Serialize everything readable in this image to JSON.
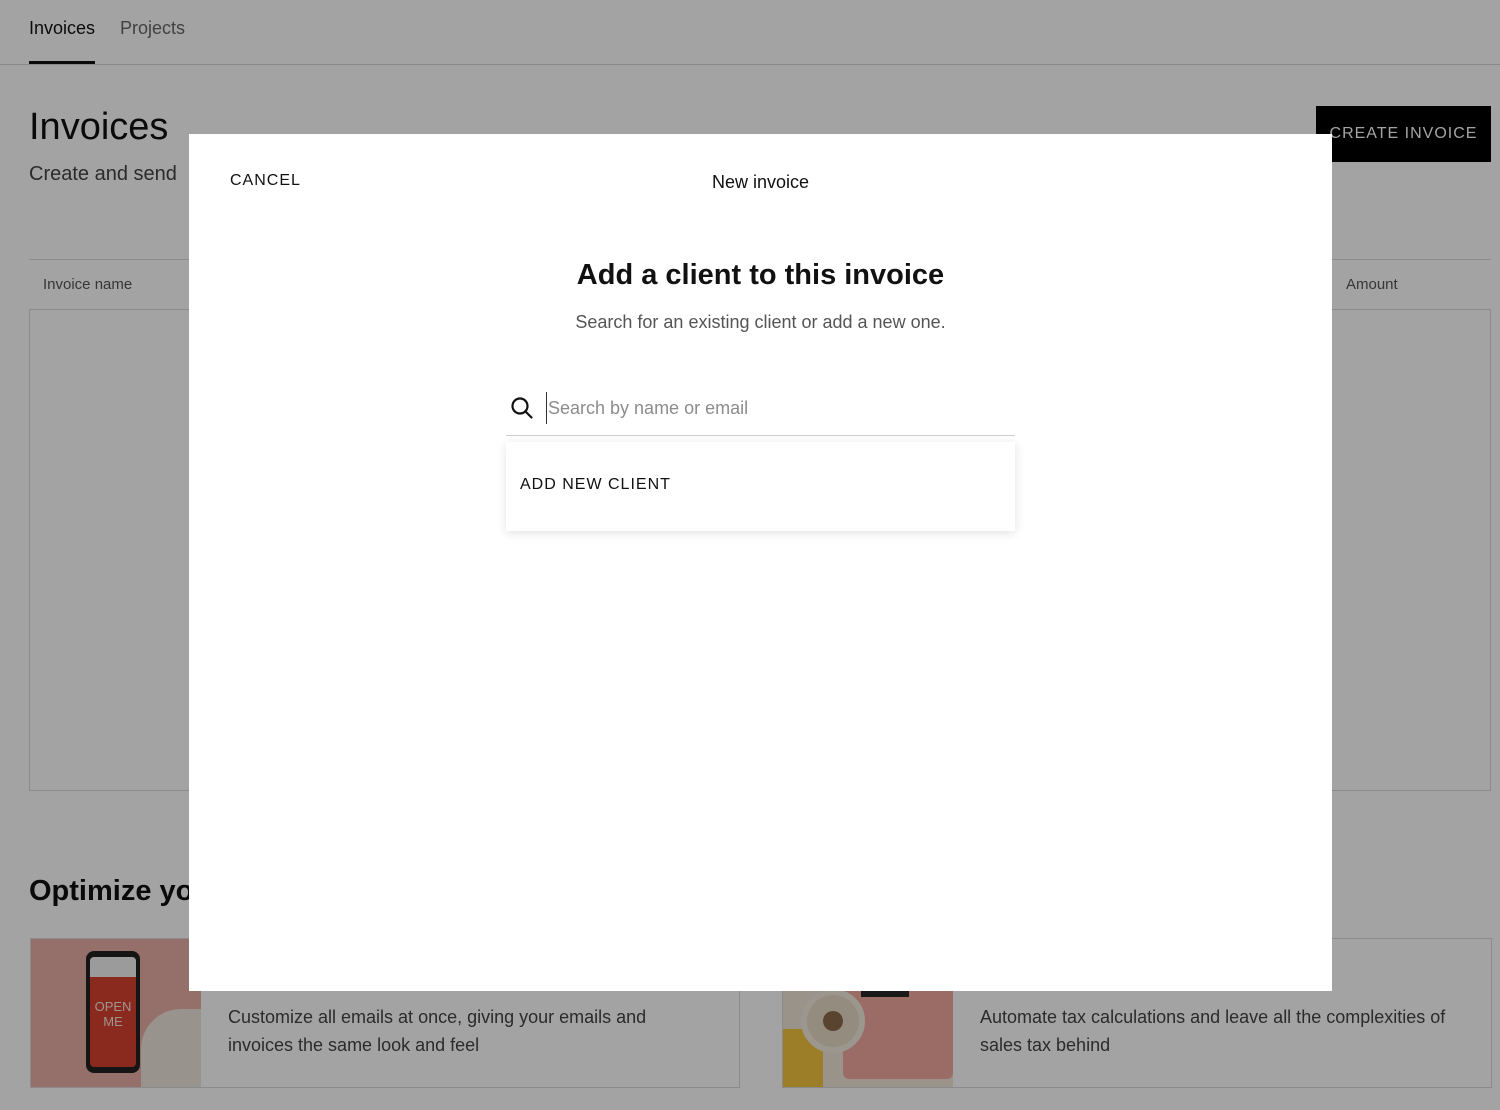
{
  "nav": {
    "tabs": [
      {
        "label": "Invoices",
        "active": true
      },
      {
        "label": "Projects",
        "active": false
      }
    ]
  },
  "page": {
    "title": "Invoices",
    "subtitle_visible": "Create and send",
    "create_button": "CREATE INVOICE"
  },
  "table": {
    "columns": [
      "Invoice name",
      "Amount"
    ]
  },
  "promo": {
    "section_title_visible": "Optimize yo",
    "cards": [
      {
        "thumb_text": "OPEN ME",
        "description": "Customize all emails at once, giving your emails and invoices the same look and feel"
      },
      {
        "description": "Automate tax calculations and leave all the complexities of sales tax behind"
      }
    ]
  },
  "modal": {
    "cancel_label": "CANCEL",
    "header_title": "New invoice",
    "heading": "Add a client to this invoice",
    "subheading": "Search for an existing client or add a new one.",
    "search": {
      "placeholder": "Search by name or email",
      "value": ""
    },
    "dropdown": {
      "add_new_label": "ADD NEW CLIENT"
    }
  },
  "colors": {
    "overlay": "#000000",
    "primary_button": "#000000",
    "text": "#111111",
    "muted_text": "#555555"
  },
  "icons": {
    "search": "search-icon"
  }
}
